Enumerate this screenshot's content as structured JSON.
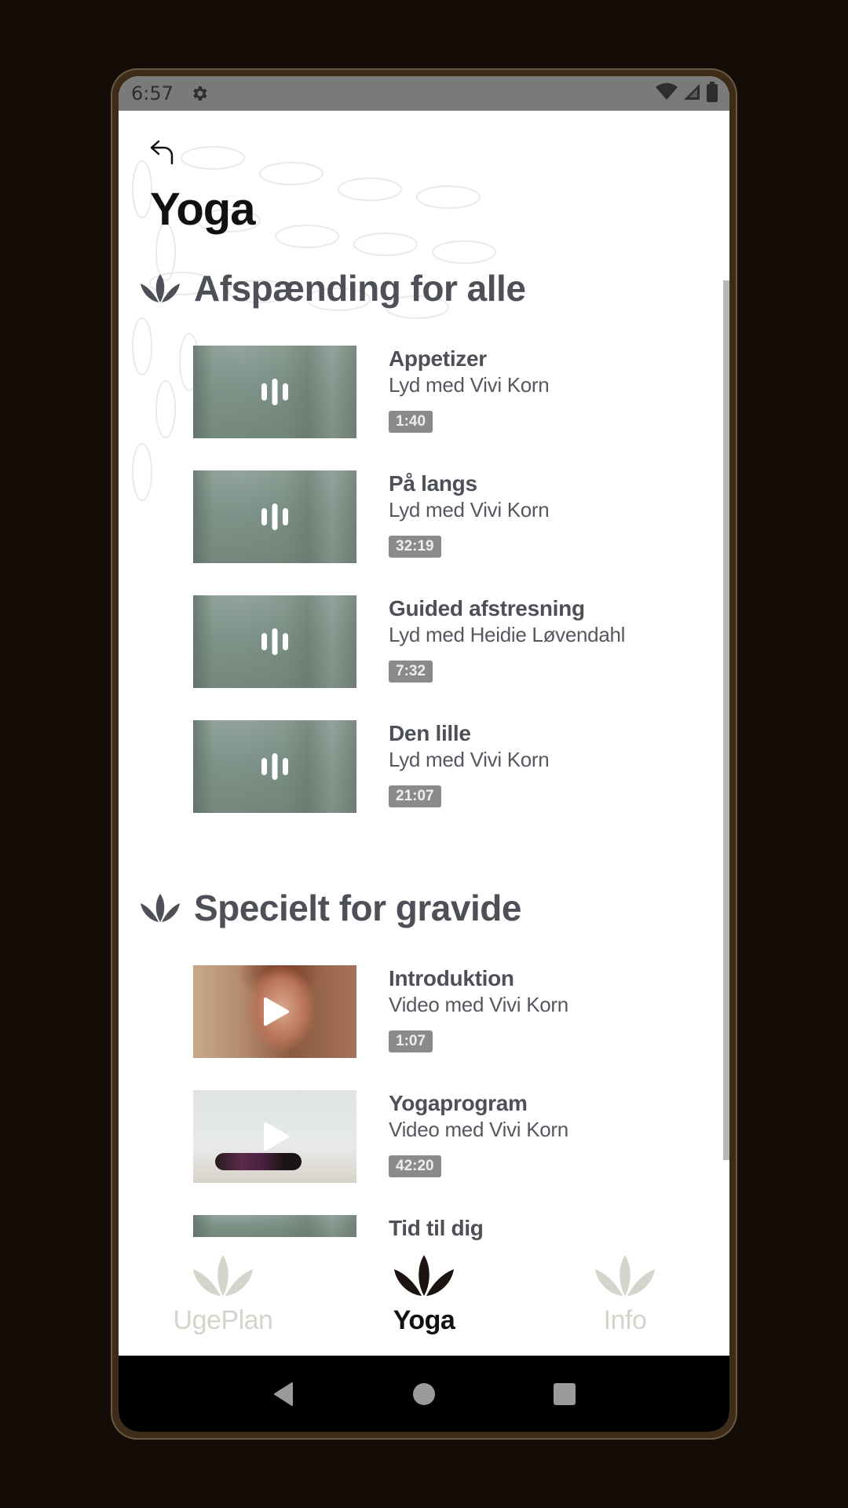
{
  "status_bar": {
    "time": "6:57",
    "icons": [
      "gear-icon",
      "wifi-icon",
      "cell-signal-icon",
      "battery-icon"
    ]
  },
  "header": {
    "back_icon": "back-arrow-icon",
    "title": "Yoga"
  },
  "sections": [
    {
      "title": "Afspænding for alle",
      "icon": "lotus-icon",
      "items": [
        {
          "title": "Appetizer",
          "subtitle": "Lyd med Vivi Korn",
          "duration": "1:40",
          "type": "audio"
        },
        {
          "title": "På langs",
          "subtitle": "Lyd med Vivi Korn",
          "duration": "32:19",
          "type": "audio"
        },
        {
          "title": "Guided afstresning",
          "subtitle": "Lyd med Heidie Løvendahl",
          "duration": "7:32",
          "type": "audio"
        },
        {
          "title": "Den lille",
          "subtitle": "Lyd med Vivi Korn",
          "duration": "21:07",
          "type": "audio"
        }
      ]
    },
    {
      "title": "Specielt for gravide",
      "icon": "lotus-icon",
      "items": [
        {
          "title": "Introduktion",
          "subtitle": "Video med Vivi Korn",
          "duration": "1:07",
          "type": "video"
        },
        {
          "title": "Yogaprogram",
          "subtitle": "Video med Vivi Korn",
          "duration": "42:20",
          "type": "video"
        },
        {
          "title": "Tid til dig",
          "type": "audio"
        }
      ]
    }
  ],
  "tab_bar": {
    "tabs": [
      {
        "label": "UgePlan",
        "active": false
      },
      {
        "label": "Yoga",
        "active": true
      },
      {
        "label": "Info",
        "active": false
      }
    ]
  },
  "nav_bar": {
    "buttons": [
      "back",
      "home",
      "recents"
    ]
  },
  "colors": {
    "active_tab": "#141010",
    "inactive_tab": "#d4d4cc",
    "section_title": "#4d5056",
    "duration_badge": "#8a8a8a",
    "device_frame": "#3d2c18"
  }
}
